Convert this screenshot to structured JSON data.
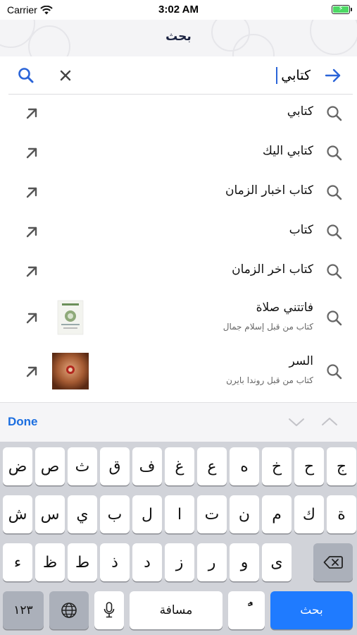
{
  "status_bar": {
    "carrier": "Carrier",
    "time": "3:02 AM",
    "battery_icon": "battery-charging-icon"
  },
  "nav": {
    "title": "بحث"
  },
  "search": {
    "value": "كتابي",
    "search_icon": "search-icon",
    "clear_icon": "clear-icon",
    "submit_icon": "arrow-right-icon",
    "accent": "#2a64d8"
  },
  "suggestions": [
    {
      "title": "كتابي"
    },
    {
      "title": "كتابي اليك"
    },
    {
      "title": "كتاب اخبار الزمان"
    },
    {
      "title": "كتاب"
    },
    {
      "title": "كتاب اخر الزمان"
    },
    {
      "title": "فاتتني صلاة",
      "subtitle": "كتاب من قبل إسلام جمال",
      "thumb": "book-cover-thumbnail"
    },
    {
      "title": "السر",
      "subtitle": "كتاب من قبل روندا بايرن",
      "thumb": "book-cover-thumbnail"
    }
  ],
  "accessory": {
    "done_label": "Done"
  },
  "keyboard": {
    "row1": [
      "ض",
      "ص",
      "ث",
      "ق",
      "ف",
      "غ",
      "ع",
      "ه",
      "خ",
      "ح",
      "ج"
    ],
    "row2": [
      "ش",
      "س",
      "ي",
      "ب",
      "ل",
      "ا",
      "ت",
      "ن",
      "م",
      "ك",
      "ة"
    ],
    "row3": [
      "ء",
      "ظ",
      "ط",
      "ذ",
      "د",
      "ز",
      "ر",
      "و",
      "ى"
    ],
    "numbers_label": "١٢٣",
    "space_label": "مسافة",
    "diacritic_label": "ًٌ",
    "go_label": "بحث",
    "go_color": "#1f7bff"
  }
}
